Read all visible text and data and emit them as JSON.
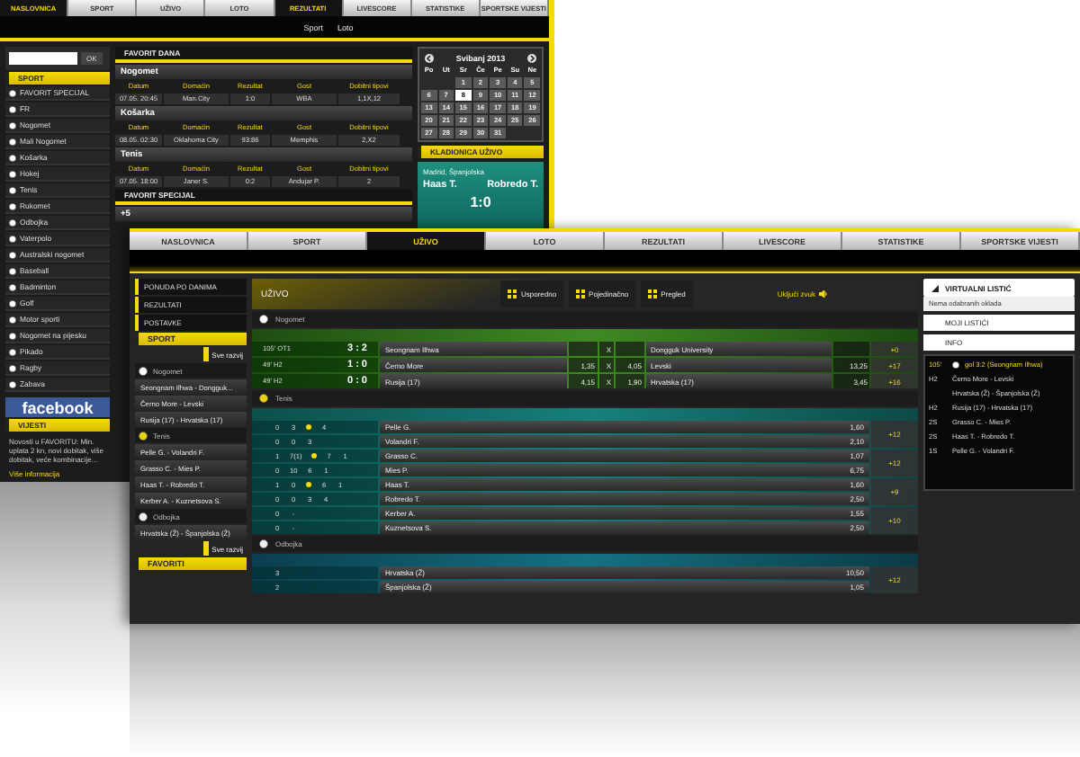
{
  "back": {
    "nav": [
      {
        "label": "NASLOVNICA",
        "selected": true
      },
      {
        "label": "SPORT",
        "selected": false
      },
      {
        "label": "UŽIVO",
        "selected": false
      },
      {
        "label": "LOTO",
        "selected": false
      },
      {
        "label": "REZULTATI",
        "selected": true
      },
      {
        "label": "LIVESCORE",
        "selected": false
      },
      {
        "label": "STATISTIKE",
        "selected": false
      },
      {
        "label": "SPORTSKE VIJESTI",
        "selected": false
      }
    ],
    "subnav": [
      "Sport",
      "Loto"
    ],
    "search": {
      "button": "OK"
    },
    "sidebar": {
      "title": "SPORT",
      "items": [
        "FAVORIT SPECIJAL",
        "FR",
        "Nogomet",
        "Mali Nogomet",
        "Košarka",
        "Hokej",
        "Tenis",
        "Rukomet",
        "Odbojka",
        "Vaterpolo",
        "Australski nogomet",
        "Baseball",
        "Badminton",
        "Golf",
        "Motor sporti",
        "Nogomet na pijesku",
        "Pikado",
        "Ragby",
        "Zabava"
      ]
    },
    "social": "facebook",
    "news": {
      "title": "VIJESTI",
      "text": "Novosti u FAVORITU: Min. uplata 2 kn, novi dobitak, više dobitak, veće kombinacije...",
      "link": "Više informacija"
    },
    "favorit_dana": {
      "title": "FAVORIT DANA",
      "sections": [
        {
          "title": "Nogomet",
          "columns": [
            "Datum",
            "Domaćin",
            "Rezultat",
            "Gost",
            "Dobitni tipovi"
          ],
          "row": [
            "07.05. 20:45",
            "Man.City",
            "1:0",
            "WBA",
            "1,1X,12"
          ]
        },
        {
          "title": "Košarka",
          "columns": [
            "Datum",
            "Domaćin",
            "Rezultat",
            "Gost",
            "Dobitni tipovi"
          ],
          "row": [
            "08.05. 02:30",
            "Oklahoma City",
            "93:86",
            "Memphis",
            "2,X2"
          ]
        },
        {
          "title": "Tenis",
          "columns": [
            "Datum",
            "Domaćin",
            "Rezultat",
            "Gost",
            "Dobitni tipovi"
          ],
          "row": [
            "07.05. 18:00",
            "Janer S.",
            "0:2",
            "Andujar P.",
            "2"
          ]
        }
      ]
    },
    "favorit_specijal": {
      "title": "FAVORIT SPECIJAL",
      "item": "+5"
    },
    "calendar": {
      "title": "Svibanj 2013",
      "weekdays": [
        "Po",
        "Ut",
        "Sr",
        "Če",
        "Pe",
        "Su",
        "Ne"
      ],
      "days": [
        {
          "label": "1",
          "selected": false
        },
        {
          "label": "2",
          "selected": false
        },
        {
          "label": "3",
          "selected": false
        },
        {
          "label": "4",
          "selected": false
        },
        {
          "label": "5",
          "selected": false
        },
        {
          "label": "6",
          "selected": false
        },
        {
          "label": "7",
          "selected": false
        },
        {
          "label": "8",
          "selected": true
        },
        {
          "label": "9",
          "selected": false
        },
        {
          "label": "10",
          "selected": false
        },
        {
          "label": "11",
          "selected": false
        },
        {
          "label": "12",
          "selected": false
        },
        {
          "label": "13",
          "selected": false
        },
        {
          "label": "14",
          "selected": false
        },
        {
          "label": "15",
          "selected": false
        },
        {
          "label": "16",
          "selected": false
        },
        {
          "label": "17",
          "selected": false
        },
        {
          "label": "18",
          "selected": false
        },
        {
          "label": "19",
          "selected": false
        },
        {
          "label": "20",
          "selected": false
        },
        {
          "label": "21",
          "selected": false
        },
        {
          "label": "22",
          "selected": false
        },
        {
          "label": "23",
          "selected": false
        },
        {
          "label": "24",
          "selected": false
        },
        {
          "label": "25",
          "selected": false
        },
        {
          "label": "26",
          "selected": false
        },
        {
          "label": "27",
          "selected": false
        },
        {
          "label": "28",
          "selected": false
        },
        {
          "label": "29",
          "selected": false
        },
        {
          "label": "30",
          "selected": false
        },
        {
          "label": "31",
          "selected": false
        }
      ]
    },
    "live_widget": {
      "title": "KLADIONICA UŽIVO",
      "location": "Madrid, Španjolska",
      "home": "Haas T.",
      "away": "Robredo T.",
      "score": "1:0"
    }
  },
  "front": {
    "nav": [
      {
        "label": "NASLOVNICA",
        "selected": false
      },
      {
        "label": "SPORT",
        "selected": false
      },
      {
        "label": "UŽIVO",
        "selected": true
      },
      {
        "label": "LOTO",
        "selected": false
      },
      {
        "label": "REZULTATI",
        "selected": false
      },
      {
        "label": "LIVESCORE",
        "selected": false
      },
      {
        "label": "STATISTIKE",
        "selected": false
      },
      {
        "label": "SPORTSKE VIJESTI",
        "selected": false
      }
    ],
    "sidebar": {
      "links": [
        "PONUDA PO DANIMA",
        "REZULTATI",
        "POSTAVKE"
      ],
      "sport_title": "SPORT",
      "expand": "Sve razvij",
      "sports": [
        {
          "name": "Nogomet",
          "kind": "football",
          "matches": [
            "Seongnam Ilhwa - Dongguk...",
            "Černo More - Levski",
            "Rusija (17) - Hrvatska (17)"
          ]
        },
        {
          "name": "Tenis",
          "kind": "tennis",
          "matches": [
            "Pelle G. - Volandri F.",
            "Grasso C. - Mies P.",
            "Haas T. - Robredo T.",
            "Kerber A. - Kuznetsova S."
          ]
        },
        {
          "name": "Odbojka",
          "kind": "volleyball",
          "matches": [
            "Hrvatska (Ž) - Španjolska (Ž)"
          ]
        }
      ],
      "expand_bottom": "Sve razvij",
      "favorites_title": "FAVORITI"
    },
    "live": {
      "title": "UŽIVO",
      "views": [
        "Usporedno",
        "Pojedinačno",
        "Pregled"
      ],
      "sound": "Uključi zvuk",
      "sections": [
        {
          "name": "Nogomet",
          "kind": "football",
          "rows": [
            {
              "time": "105' OT1",
              "score": "3 : 2",
              "home": "Seongnam Ilhwa",
              "x": "X",
              "away": "Dongguk University",
              "more": "+0"
            },
            {
              "time": "49' H2",
              "score": "1 : 0",
              "home": "Černo More",
              "odd1": "1,35",
              "x": "X",
              "oddx": "4,05",
              "away": "Levski",
              "odd2": "13,25",
              "more": "+17"
            },
            {
              "time": "49' H2",
              "score": "0 : 0",
              "home": "Rusija (17)",
              "odd1": "4,15",
              "x": "X",
              "oddx": "1,90",
              "away": "Hrvatska (17)",
              "odd2": "3,45",
              "more": "+16"
            }
          ]
        },
        {
          "name": "Tenis",
          "kind": "tennis",
          "matches": [
            {
              "more": "+12",
              "players": [
                {
                  "sets": [
                    "0",
                    "3",
                    "4"
                  ],
                  "serving": true,
                  "name": "Pelle G.",
                  "odd": "1,60"
                },
                {
                  "sets": [
                    "0",
                    "0",
                    "3"
                  ],
                  "serving": false,
                  "name": "Volandri F.",
                  "odd": "2,10"
                }
              ]
            },
            {
              "more": "+12",
              "players": [
                {
                  "sets": [
                    "1",
                    "7(1)",
                    "7",
                    "1"
                  ],
                  "serving": true,
                  "name": "Grasso C.",
                  "odd": "1,07"
                },
                {
                  "sets": [
                    "0",
                    "10",
                    "6",
                    "1"
                  ],
                  "serving": false,
                  "name": "Mies P.",
                  "odd": "6,75"
                }
              ]
            },
            {
              "more": "+9",
              "players": [
                {
                  "sets": [
                    "1",
                    "0",
                    "6",
                    "1"
                  ],
                  "serving": true,
                  "name": "Haas T.",
                  "odd": "1,60"
                },
                {
                  "sets": [
                    "0",
                    "0",
                    "3",
                    "4"
                  ],
                  "serving": false,
                  "name": "Robredo T.",
                  "odd": "2,50"
                }
              ]
            },
            {
              "more": "+10",
              "players": [
                {
                  "sets": [
                    "0",
                    "-"
                  ],
                  "serving": false,
                  "name": "Kerber A.",
                  "odd": "1,55"
                },
                {
                  "sets": [
                    "0",
                    "-"
                  ],
                  "serving": false,
                  "name": "Kuznetsova S.",
                  "odd": "2,50"
                }
              ]
            }
          ]
        },
        {
          "name": "Odbojka",
          "kind": "volleyball",
          "matches": [
            {
              "more": "+12",
              "players": [
                {
                  "sets": [
                    "3"
                  ],
                  "name": "Hrvatska (Ž)",
                  "odd": "10,50"
                },
                {
                  "sets": [
                    "2"
                  ],
                  "name": "Španjolska (Ž)",
                  "odd": "1,05"
                }
              ]
            }
          ]
        }
      ]
    },
    "slip": {
      "title": "VIRTUALNI LISTIĆ",
      "empty": "Nema odabranih oklada",
      "tabs": [
        "MOJI LISTIĆI",
        "INFO"
      ],
      "info": [
        {
          "time": "105'",
          "text": "gol 3:2 (Seongnam Ilhwa)",
          "kind": "goal"
        },
        {
          "time": "H2",
          "text": "Černo More - Levski",
          "kind": "event"
        },
        {
          "text": "Hrvatska (Ž) - Španjolska (Ž)",
          "kind": "event"
        },
        {
          "time": "H2",
          "text": "Rusija (17) - Hrvatska (17)",
          "kind": "event"
        },
        {
          "time": "2S",
          "text": "Grasso C. - Mies P.",
          "kind": "event"
        },
        {
          "time": "2S",
          "text": "Haas T. - Robredo T.",
          "kind": "event"
        },
        {
          "time": "1S",
          "text": "Pelle G. - Volandri F.",
          "kind": "event"
        }
      ]
    }
  }
}
